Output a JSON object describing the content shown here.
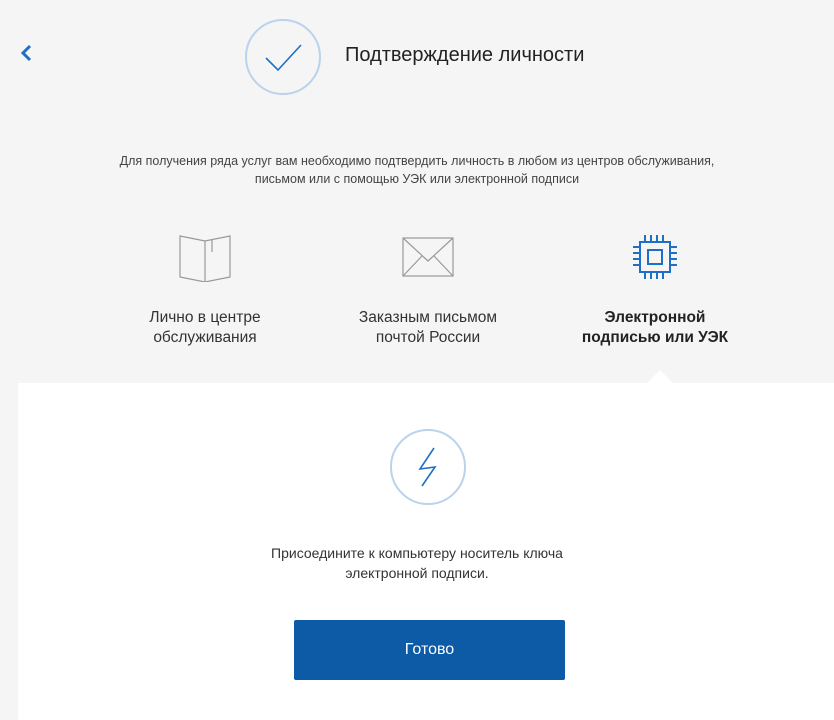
{
  "header": {
    "back_icon": "chevron-left-icon",
    "check_icon": "checkmark-circle-icon",
    "title": "Подтверждение личности"
  },
  "intro": {
    "line1": "Для получения ряда услуг вам необходимо подтвердить личность в любом из центров обслуживания,",
    "line2": "письмом или с помощью УЭК или электронной подписи"
  },
  "methods": [
    {
      "icon": "book-icon",
      "line1": "Лично в центре",
      "line2": "обслуживания",
      "active": false
    },
    {
      "icon": "envelope-icon",
      "line1": "Заказным письмом",
      "line2": "почтой России",
      "active": false
    },
    {
      "icon": "chip-icon",
      "line1": "Электронной",
      "line2": "подписью или УЭК",
      "active": true
    }
  ],
  "panel": {
    "icon": "lightning-circle-icon",
    "text_line1": "Присоедините к компьютеру носитель ключа",
    "text_line2": "электронной подписи.",
    "button_label": "Готово"
  },
  "colors": {
    "accent": "#0d5aa7",
    "icon_blue": "#1f6fc5",
    "circle_stroke": "#b9d3ec",
    "icon_gray": "#999999",
    "background": "#f5f5f5"
  }
}
